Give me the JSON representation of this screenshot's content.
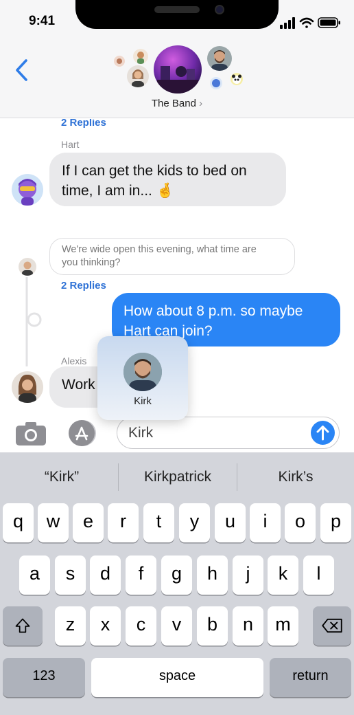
{
  "status_bar": {
    "time": "9:41",
    "icons": [
      "signal-icon",
      "wifi-icon",
      "battery-icon"
    ]
  },
  "header": {
    "group_name": "The Band"
  },
  "messages": {
    "replies_top": "2 Replies",
    "hart_sender": "Hart",
    "hart_line1": "If I can get the kids to bed on",
    "hart_line2": "time, I am in... 🤞",
    "quote_line1": "We're wide open this evening, what time are",
    "quote_line2": "you thinking?",
    "replies_mid": "2 Replies",
    "outgoing_line1": "How about 8 p.m. so maybe",
    "outgoing_line2": "Hart can join?",
    "alexis_sender": "Alexis",
    "alexis_text": "Work"
  },
  "mention_popup": {
    "name": "Kirk"
  },
  "input": {
    "value": "Kirk"
  },
  "keyboard": {
    "suggestions": [
      "“Kirk”",
      "Kirkpatrick",
      "Kirk’s"
    ],
    "row1": [
      "q",
      "w",
      "e",
      "r",
      "t",
      "y",
      "u",
      "i",
      "o",
      "p"
    ],
    "row2": [
      "a",
      "s",
      "d",
      "f",
      "g",
      "h",
      "j",
      "k",
      "l"
    ],
    "row3": [
      "z",
      "x",
      "c",
      "v",
      "b",
      "n",
      "m"
    ],
    "numbers_label": "123",
    "space_label": "space",
    "return_label": "return"
  },
  "colors": {
    "accent": "#2a85f5",
    "link": "#2f72d6",
    "incoming_bubble": "#e9e9eb",
    "keyboard_bg": "#d3d5db"
  }
}
